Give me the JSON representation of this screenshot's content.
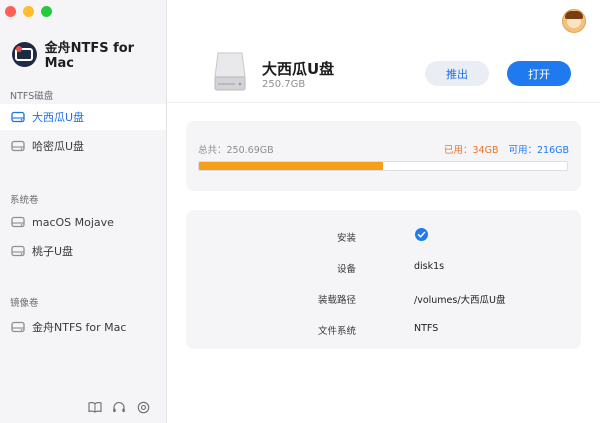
{
  "app": {
    "name": "金舟NTFS for Mac"
  },
  "sidebar": {
    "sections": [
      {
        "label": "NTFS磁盘",
        "items": [
          {
            "label": "大西瓜U盘"
          },
          {
            "label": "哈密瓜U盘"
          }
        ]
      },
      {
        "label": "系统卷",
        "items": [
          {
            "label": "macOS Mojave"
          },
          {
            "label": "桃子U盘"
          }
        ]
      },
      {
        "label": "镜像卷",
        "items": [
          {
            "label": "金舟NTFS for Mac"
          }
        ]
      }
    ]
  },
  "drive": {
    "name": "大西瓜U盘",
    "size": "250.7GB",
    "eject_label": "推出",
    "open_label": "打开"
  },
  "usage": {
    "total": "总共：250.69GB",
    "used": "已用：34GB",
    "free": "可用：216GB",
    "used_fraction": 0.5
  },
  "info": {
    "rows": [
      {
        "label": "安装",
        "value": ""
      },
      {
        "label": "设备",
        "value": "disk1s"
      },
      {
        "label": "装载路径",
        "value": "/volumes/大西瓜U盘"
      },
      {
        "label": "文件系统",
        "value": "NTFS"
      }
    ]
  },
  "colors": {
    "accent": "#1f7af0",
    "used": "#e8742a",
    "bar_fill": "#f5a01a"
  }
}
